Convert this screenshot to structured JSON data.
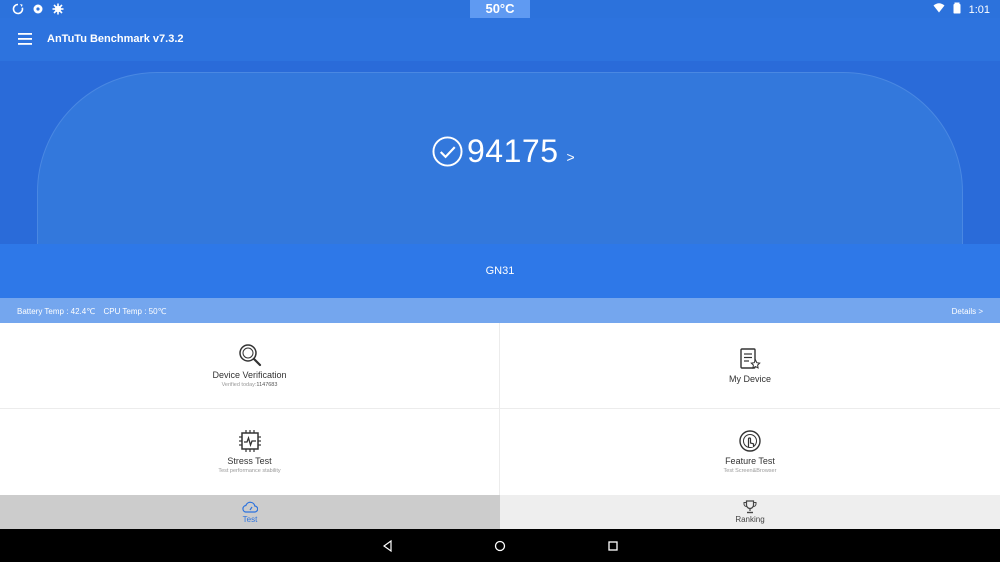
{
  "status_bar": {
    "cpu_temp": "50°C",
    "time": "1:01"
  },
  "app_bar": {
    "title": "AnTuTu Benchmark v7.3.2"
  },
  "hero": {
    "score": "94175",
    "score_arrow": ">",
    "device_name": "GN31"
  },
  "temps": {
    "battery": "Battery Temp : 42.4℃",
    "cpu": "CPU Temp : 50℃",
    "details": "Details >"
  },
  "grid": {
    "device_verification": {
      "title": "Device Verification",
      "sub_label": "Verified today:",
      "sub_value": "1147683"
    },
    "my_device": {
      "title": "My Device"
    },
    "stress_test": {
      "title": "Stress Test",
      "sub": "Test performance stability"
    },
    "feature_test": {
      "title": "Feature Test",
      "sub": "Test Screen&Browser"
    }
  },
  "tabs": {
    "test": "Test",
    "ranking": "Ranking"
  },
  "colors": {
    "accent": "#2d73de",
    "hero": "#2a6bd9",
    "band": "#2e78e8",
    "temp_bar": "#74a6ee"
  }
}
